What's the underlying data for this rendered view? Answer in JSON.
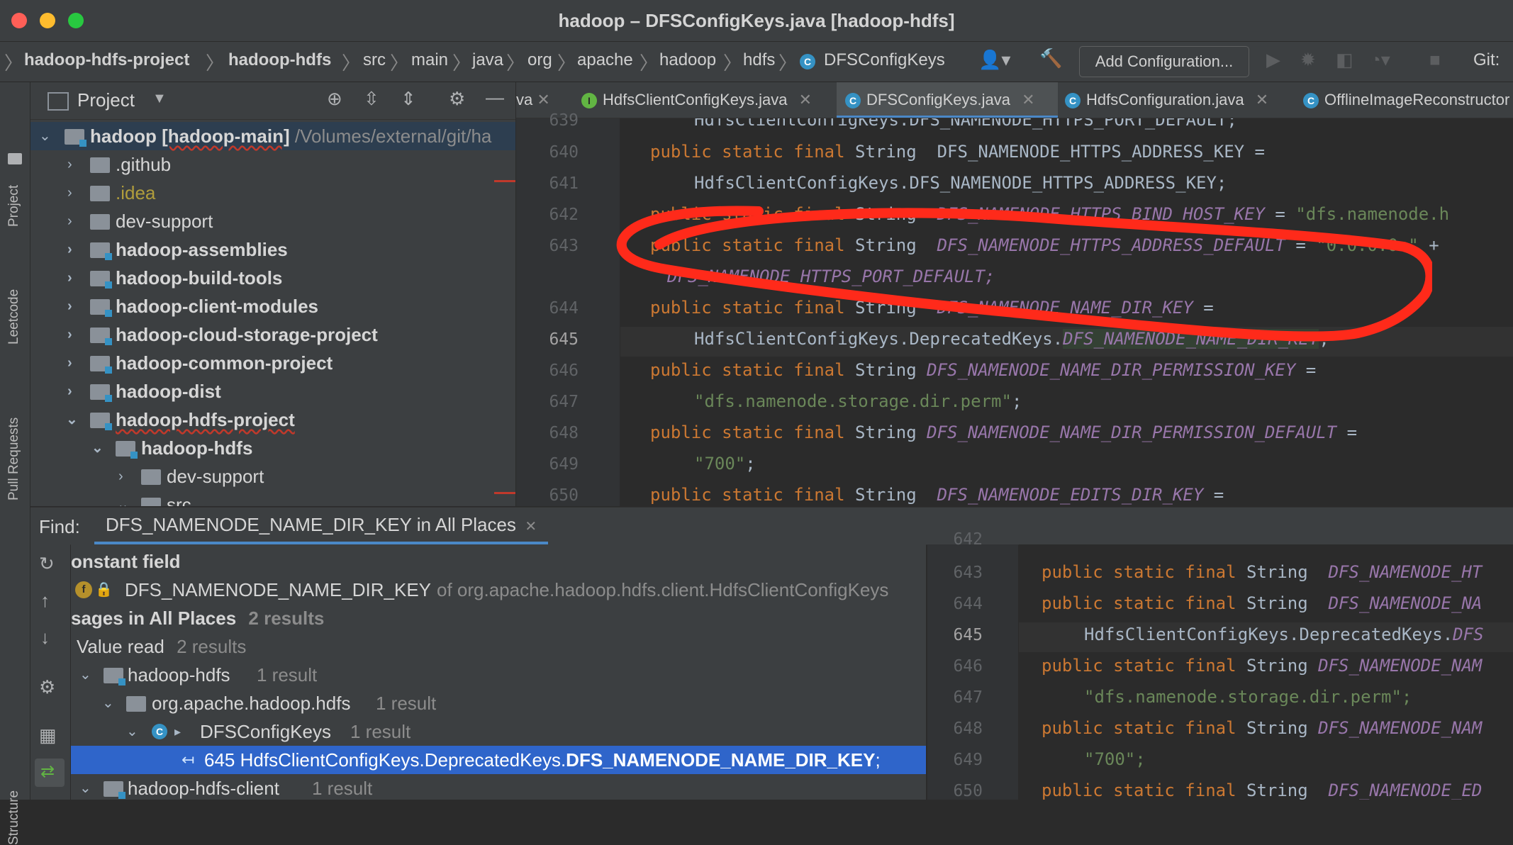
{
  "window": {
    "title": "hadoop – DFSConfigKeys.java [hadoop-hdfs]"
  },
  "breadcrumbs": [
    "hadoop-hdfs-project",
    "hadoop-hdfs",
    "src",
    "main",
    "java",
    "org",
    "apache",
    "hadoop",
    "hdfs",
    "DFSConfigKeys"
  ],
  "toolbar": {
    "add_configuration": "Add Configuration...",
    "git_label": "Git:"
  },
  "left_strip": {
    "project": "Project",
    "leetcode": "Leetcode",
    "pull_requests": "Pull Requests",
    "structure": "Structure"
  },
  "project_panel": {
    "title": "Project",
    "root_name": "hadoop",
    "root_module": "[hadoop-main]",
    "root_path": "/Volumes/external/git/ha",
    "items": [
      ".github",
      ".idea",
      "dev-support",
      "hadoop-assemblies",
      "hadoop-build-tools",
      "hadoop-client-modules",
      "hadoop-cloud-storage-project",
      "hadoop-common-project",
      "hadoop-dist",
      "hadoop-hdfs-project",
      "hadoop-hdfs",
      "dev-support",
      "src"
    ]
  },
  "editor_tabs": [
    "va",
    "HdfsClientConfigKeys.java",
    "DFSConfigKeys.java",
    "HdfsConfiguration.java",
    "OfflineImageReconstructor"
  ],
  "code": {
    "line_numbers": [
      "639",
      "640",
      "641",
      "642",
      "643",
      "644",
      "645",
      "646",
      "647",
      "648",
      "649",
      "650"
    ],
    "kw": "public static final",
    "type": "String",
    "l639": "HdfsClientConfigKeys.DFS_NAMENODE_HTTPS_PORT_DEFAULT;",
    "l640": "DFS_NAMENODE_HTTPS_ADDRESS_KEY",
    "l641": "HdfsClientConfigKeys.DFS_NAMENODE_HTTPS_ADDRESS_KEY;",
    "l642": "DFS_NAMENODE_HTTPS_BIND_HOST_KEY",
    "l642_str": "\"dfs.namenode.h",
    "l643": "DFS_NAMENODE_HTTPS_ADDRESS_DEFAULT",
    "l643_str": "\"0.0.0.0:\"",
    "l643b": "DFS_NAMENODE_HTTPS_PORT_DEFAULT;",
    "l644": "DFS_NAMENODE_NAME_DIR_KEY",
    "l645a": "HdfsClientConfigKeys.DeprecatedKeys.",
    "l645b": "DFS_NAMENODE_NAME_DIR_KEY",
    "l646": "DFS_NAMENODE_NAME_DIR_PERMISSION_KEY",
    "l647": "\"dfs.namenode.storage.dir.perm\"",
    "l648": "DFS_NAMENODE_NAME_DIR_PERMISSION_DEFAULT",
    "l649": "\"700\"",
    "l650": "DFS_NAMENODE_EDITS_DIR_KEY"
  },
  "find": {
    "label": "Find:",
    "tab": "DFS_NAMENODE_NAME_DIR_KEY in All Places",
    "constant_field": "onstant field",
    "field_name": "DFS_NAMENODE_NAME_DIR_KEY",
    "field_of": "of org.apache.hadoop.hdfs.client.HdfsClientConfigKeys",
    "usages": "sages in All Places",
    "usages_count": "2 results",
    "value_read": "Value read",
    "value_read_count": "2 results",
    "module1": "hadoop-hdfs",
    "module1_count": "1 result",
    "package": "org.apache.hadoop.hdfs",
    "package_count": "1 result",
    "class": "DFSConfigKeys",
    "class_count": "1 result",
    "match_prefix": "645 HdfsClientConfigKeys.DeprecatedKeys.",
    "match_bold": "DFS_NAMENODE_NAME_DIR_KEY",
    "match_suffix": ";",
    "module2": "hadoop-hdfs-client",
    "module2_count": "1 result"
  },
  "preview": {
    "line_numbers": [
      "642",
      "643",
      "644",
      "645",
      "646",
      "647",
      "648",
      "649",
      "650"
    ],
    "p643": "DFS_NAMENODE_HT",
    "p644": "DFS_NAMENODE_NA",
    "p645a": "HdfsClientConfigKeys.DeprecatedKeys.",
    "p645b": "DFS",
    "p646": "DFS_NAMENODE_NAM",
    "p647": "\"dfs.namenode.storage.dir.perm\";",
    "p648": "DFS_NAMENODE_NAM",
    "p649": "\"700\";",
    "p650": "DFS_NAMENODE_ED"
  },
  "colors": {
    "keyword": "#cc7832",
    "constant": "#9876aa",
    "string": "#6a8759",
    "selection": "#2f65ca",
    "annotation": "#ff2a1a"
  }
}
